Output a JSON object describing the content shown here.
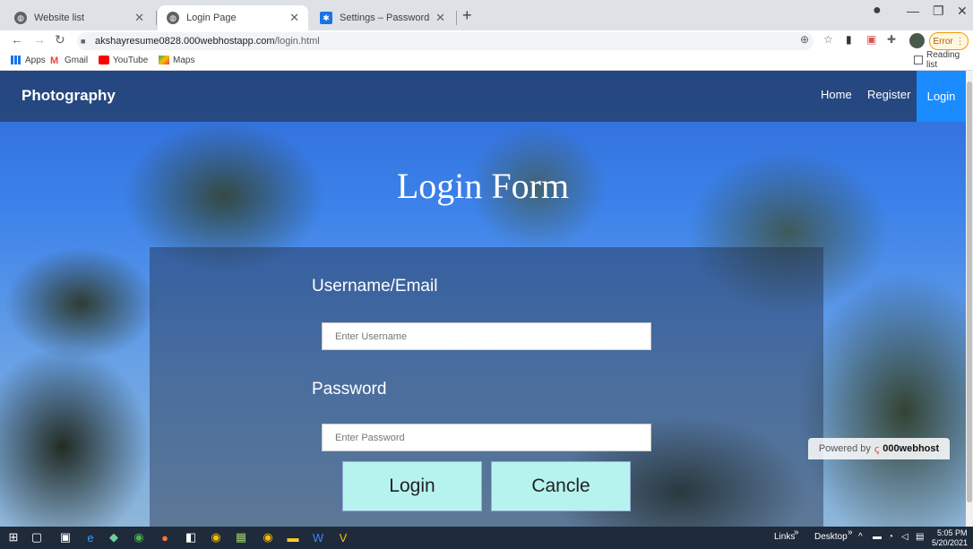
{
  "browser": {
    "tabs": [
      {
        "title": "Website list",
        "icon": "globe-icon",
        "active": false
      },
      {
        "title": "Login Page",
        "icon": "globe-icon",
        "active": true
      },
      {
        "title": "Settings – Passwords",
        "icon": "gear-icon",
        "active": false
      }
    ],
    "new_tab": "+",
    "url_domain": "akshayresume0828.000webhostapp.com",
    "url_path": "/login.html",
    "profile_error": "Error",
    "bookmarks": [
      {
        "label": "Apps",
        "icon": "apps-grid-icon"
      },
      {
        "label": "Gmail",
        "icon": "gmail-icon"
      },
      {
        "label": "YouTube",
        "icon": "youtube-icon"
      },
      {
        "label": "Maps",
        "icon": "maps-icon"
      }
    ],
    "reading_list": "Reading list"
  },
  "page": {
    "brand": "Photography",
    "nav": [
      "Home",
      "Register",
      "Login"
    ],
    "heading": "Login Form",
    "username_label": "Username/Email",
    "username_placeholder": "Enter Username",
    "password_label": "Password",
    "password_placeholder": "Enter Password",
    "login_button": "Login",
    "cancel_button": "Cancle",
    "powered_by": "Powered by",
    "powered_brand": "000webhost"
  },
  "taskbar": {
    "links": "Links",
    "desktop": "Desktop",
    "time": "5:05 PM",
    "date": "5/20/2021"
  },
  "colors": {
    "nav_active": "#1a8cff",
    "button_bg": "#b7f3ee",
    "tab_strip": "#dee1e6"
  }
}
